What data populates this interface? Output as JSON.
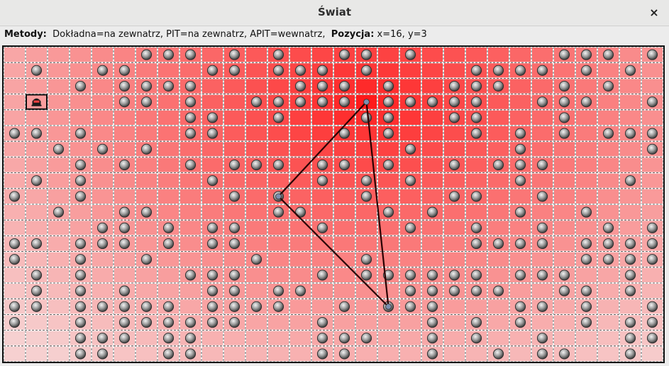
{
  "window": {
    "title": "Świat",
    "close_label": "×"
  },
  "status_bar": {
    "methods_label": "Metody:",
    "methods_text": "Dokładna=na zewnatrz, PIT=na zewnatrz, APIT=wewnatrz,",
    "position_label": "Pozycja:",
    "position_text": "x=16, y=3"
  },
  "world": {
    "columns": 30,
    "rows": 20,
    "colors": {
      "heat_center": "#ff1a1a",
      "heat_edge": "#f6d0d0",
      "grid_line": "#ffffff",
      "triangle": "#2a0000",
      "node_fill": "#9a9a9a"
    },
    "heat_center": {
      "col": 16,
      "row": 3
    },
    "selected_cell": {
      "col": 1,
      "row": 3,
      "icon": "robot-icon"
    },
    "triangle_anchors": [
      {
        "col": 16.5,
        "row": 3.5
      },
      {
        "col": 12.5,
        "row": 9.5
      },
      {
        "col": 17.5,
        "row": 16.5
      }
    ],
    "node_icon": "sensor-node-icon",
    "nodes_by_row": [
      [
        6,
        7,
        8,
        10,
        12,
        15,
        16,
        18,
        25,
        26,
        27,
        29
      ],
      [
        1,
        4,
        5,
        9,
        10,
        12,
        13,
        14,
        16,
        21,
        22,
        23,
        24,
        26,
        28
      ],
      [
        3,
        5,
        6,
        7,
        8,
        13,
        14,
        15,
        17,
        20,
        21,
        22,
        25,
        27
      ],
      [
        5,
        6,
        8,
        11,
        12,
        13,
        14,
        15,
        17,
        18,
        19,
        20,
        21,
        24,
        25,
        26,
        29
      ],
      [
        8,
        9,
        12,
        16,
        17,
        20,
        21,
        25
      ],
      [
        0,
        1,
        3,
        8,
        9,
        15,
        17,
        21,
        23,
        25,
        27,
        28,
        29
      ],
      [
        2,
        4,
        6,
        18,
        23,
        29
      ],
      [
        3,
        5,
        8,
        10,
        11,
        12,
        14,
        15,
        17,
        20,
        22,
        23,
        24
      ],
      [
        1,
        3,
        9,
        14,
        16,
        18,
        23,
        28
      ],
      [
        0,
        3,
        10,
        12,
        16,
        20,
        21,
        24
      ],
      [
        2,
        5,
        6,
        12,
        13,
        17,
        19,
        23,
        26
      ],
      [
        4,
        5,
        7,
        9,
        10,
        14,
        18,
        21,
        24,
        27,
        29
      ],
      [
        0,
        1,
        3,
        4,
        5,
        7,
        9,
        10,
        21,
        22,
        23,
        24,
        26,
        27,
        28,
        29
      ],
      [
        0,
        3,
        6,
        11,
        16,
        26,
        27,
        28,
        29
      ],
      [
        1,
        3,
        8,
        9,
        10,
        14,
        16,
        17,
        18,
        19,
        20,
        21,
        23,
        24,
        25,
        28
      ],
      [
        1,
        3,
        5,
        9,
        10,
        12,
        13,
        18,
        19,
        20,
        21,
        22,
        25,
        26,
        28
      ],
      [
        0,
        1,
        3,
        4,
        5,
        6,
        7,
        9,
        10,
        11,
        12,
        15,
        17,
        18,
        19,
        23,
        24,
        26,
        29
      ],
      [
        0,
        3,
        5,
        6,
        7,
        8,
        9,
        10,
        14,
        19,
        21,
        23,
        26,
        28,
        29
      ],
      [
        3,
        4,
        5,
        7,
        8,
        14,
        15,
        16,
        19,
        21,
        24,
        28,
        29
      ],
      [
        3,
        4,
        7,
        8,
        14,
        15,
        19,
        22,
        24,
        25,
        28
      ]
    ]
  }
}
